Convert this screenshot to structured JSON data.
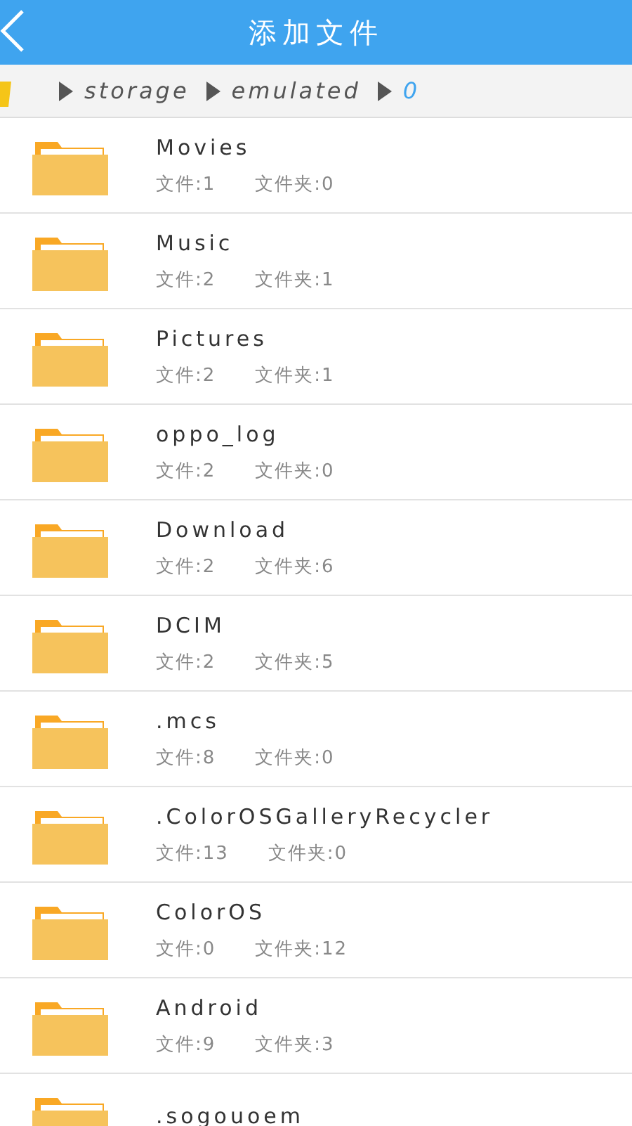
{
  "header": {
    "title": "添加文件"
  },
  "breadcrumb": [
    {
      "label": "storage",
      "selected": false
    },
    {
      "label": "emulated",
      "selected": false
    },
    {
      "label": "0",
      "selected": true
    }
  ],
  "folders": [
    {
      "name": "Movies",
      "files": "文件:1",
      "dirs": "文件夹:0"
    },
    {
      "name": "Music",
      "files": "文件:2",
      "dirs": "文件夹:1"
    },
    {
      "name": "Pictures",
      "files": "文件:2",
      "dirs": "文件夹:1"
    },
    {
      "name": "oppo_log",
      "files": "文件:2",
      "dirs": "文件夹:0"
    },
    {
      "name": "Download",
      "files": "文件:2",
      "dirs": "文件夹:6"
    },
    {
      "name": "DCIM",
      "files": "文件:2",
      "dirs": "文件夹:5"
    },
    {
      "name": ".mcs",
      "files": "文件:8",
      "dirs": "文件夹:0"
    },
    {
      "name": ".ColorOSGalleryRecycler",
      "files": "文件:13",
      "dirs": "文件夹:0"
    },
    {
      "name": "ColorOS",
      "files": "文件:0",
      "dirs": "文件夹:12"
    },
    {
      "name": "Android",
      "files": "文件:9",
      "dirs": "文件夹:3"
    },
    {
      "name": ".sogouoem"
    }
  ]
}
